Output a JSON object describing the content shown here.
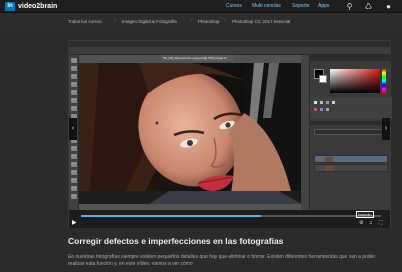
{
  "topbar": {
    "logo": "in",
    "brand": "video2brain",
    "nav": [
      "Cursos",
      "Multi cenclas",
      "Soporte",
      "Apps"
    ],
    "icons": [
      "search-icon",
      "cart-icon",
      "user-icon"
    ],
    "cart_count": "0"
  },
  "breadcrumb": [
    "Todos los cursos",
    "Imagen Digital & Fotografía",
    "Photoshop",
    "Photoshop CC 2017 esencial"
  ],
  "photoshop": {
    "doc_tab": "SK_DB_Retouch-IGL-copy.psd@ 50% (Capa 0)"
  },
  "video": {
    "progress": 0.6,
    "watermark": "linkedin"
  },
  "content": {
    "title": "Corregir defectos e imperfecciones en las fotografías",
    "description": "En nuestras fotografías siempre existen pequeños detalles que hay que eliminar o borrar. Existen diferentes herramientas que van a poder realizar esta función y, en este vídeo, vamos a ver cómo"
  }
}
